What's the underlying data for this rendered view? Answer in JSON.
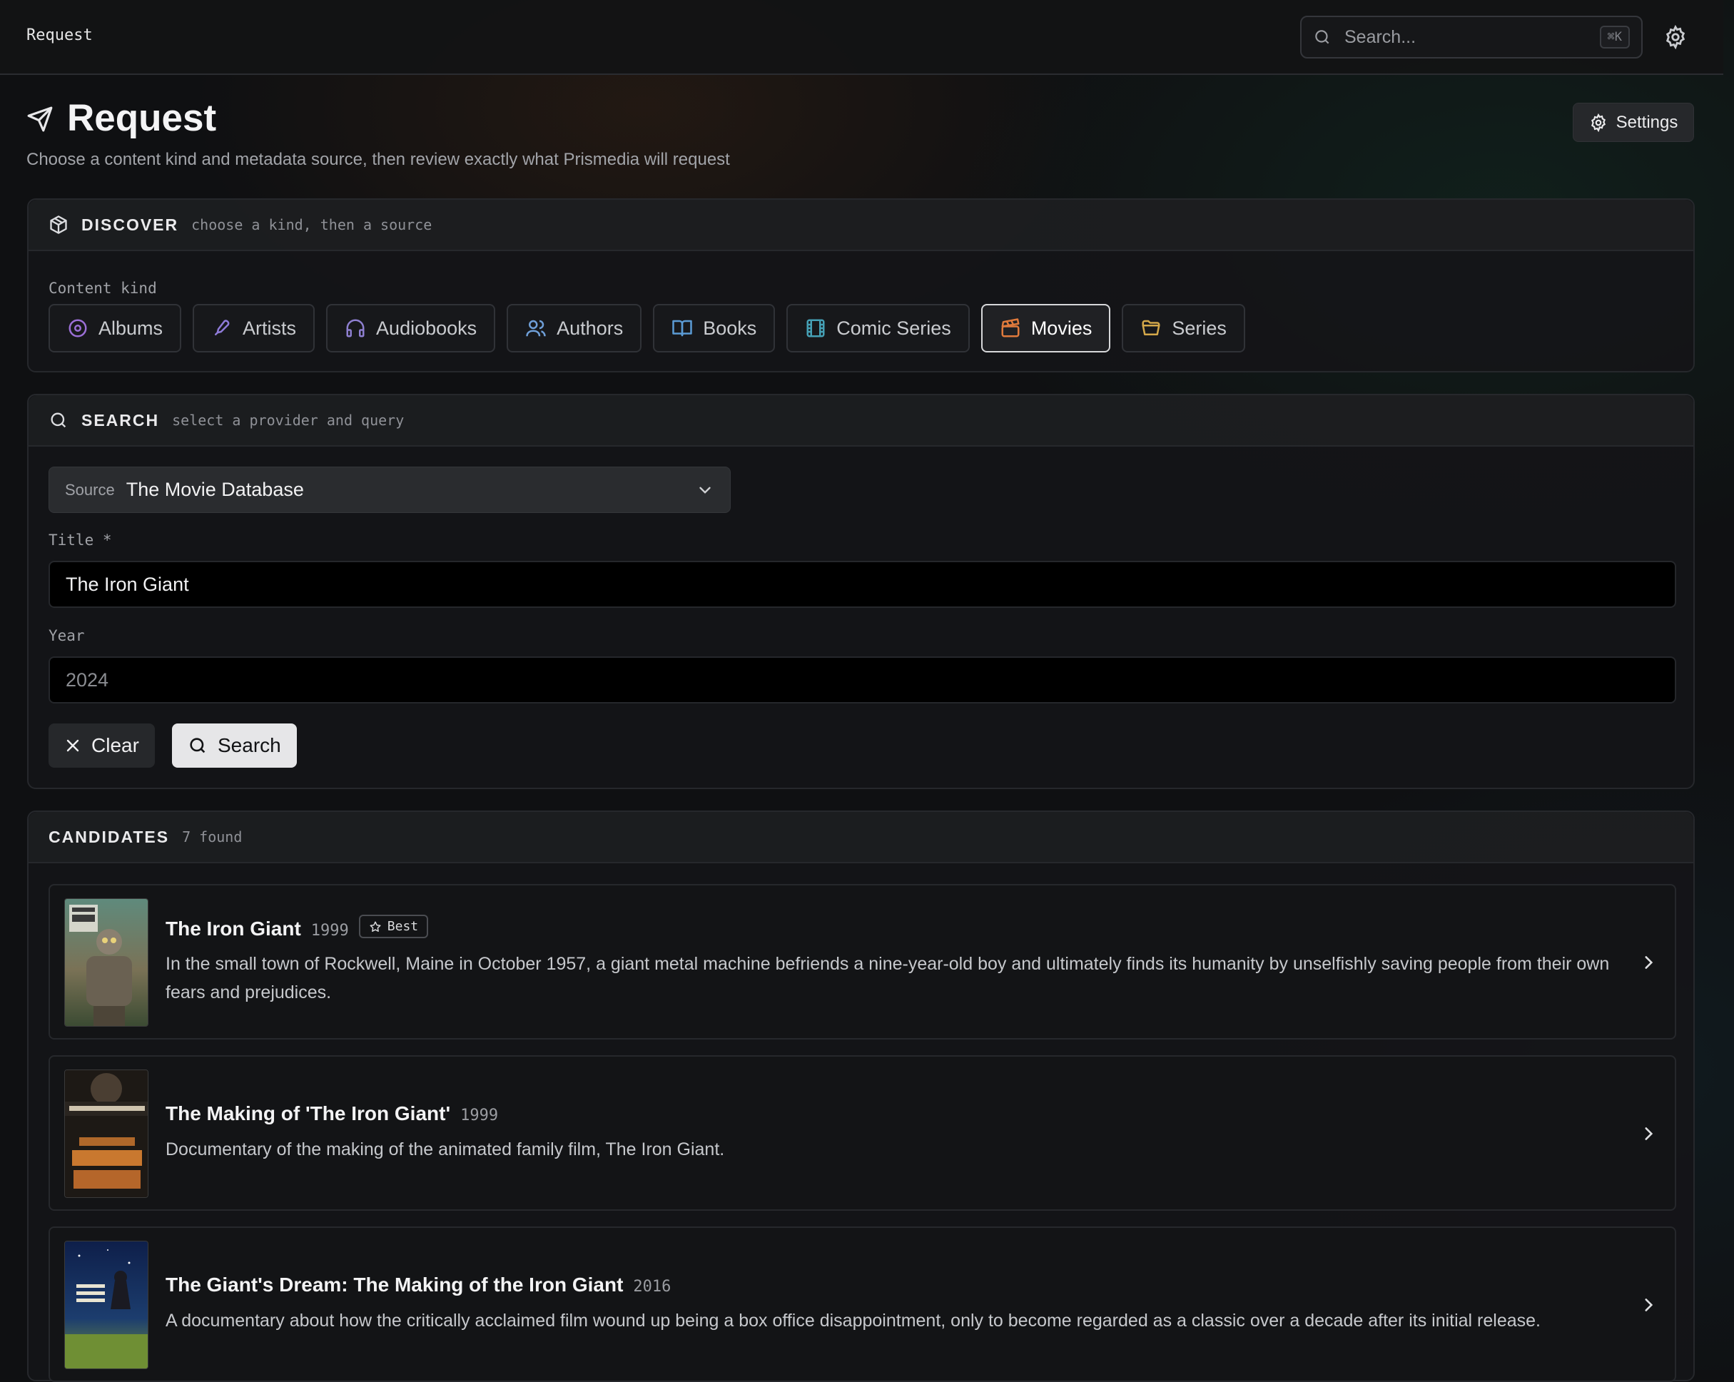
{
  "topbar": {
    "breadcrumb": "Request",
    "search_placeholder": "Search...",
    "shortcut": "⌘K",
    "gear_icon": "gear-icon"
  },
  "header": {
    "title": "Request",
    "subtitle": "Choose a content kind and metadata source, then review exactly what Prismedia will request",
    "settings_label": "Settings"
  },
  "discover": {
    "title": "DISCOVER",
    "hint": "choose a kind, then a source",
    "kind_label": "Content kind",
    "kinds": [
      {
        "label": "Albums",
        "icon": "disc-icon",
        "color": "#9b6fd6"
      },
      {
        "label": "Artists",
        "icon": "mic-icon",
        "color": "#8f7bd9"
      },
      {
        "label": "Audiobooks",
        "icon": "headphones-icon",
        "color": "#8e7fd0"
      },
      {
        "label": "Authors",
        "icon": "users-icon",
        "color": "#6f9fd8"
      },
      {
        "label": "Books",
        "icon": "book-icon",
        "color": "#5b9bd5"
      },
      {
        "label": "Comic Series",
        "icon": "film-strip-icon",
        "color": "#45a0b5"
      },
      {
        "label": "Movies",
        "icon": "clapperboard-icon",
        "color": "#e07a3c",
        "active": true
      },
      {
        "label": "Series",
        "icon": "folder-icon",
        "color": "#d4a84a"
      }
    ]
  },
  "search": {
    "title": "SEARCH",
    "hint": "select a provider and query",
    "source_label": "Source",
    "source_value": "The Movie Database",
    "title_label": "Title *",
    "title_value": "The Iron Giant",
    "year_label": "Year",
    "year_placeholder": "2024",
    "clear_label": "Clear",
    "search_label": "Search"
  },
  "candidates": {
    "title": "CANDIDATES",
    "count": "7 found",
    "items": [
      {
        "title": "The Iron Giant",
        "year": "1999",
        "badge": "Best",
        "description": "In the small town of Rockwell, Maine in October 1957, a giant metal machine befriends a nine-year-old boy and ultimately finds its humanity by unselfishly saving people from their own fears and prejudices."
      },
      {
        "title": "The Making of 'The Iron Giant'",
        "year": "1999",
        "description": "Documentary of the making of the animated family film, The Iron Giant."
      },
      {
        "title": "The Giant's Dream: The Making of the Iron Giant",
        "year": "2016",
        "description": "A documentary about how the critically acclaimed film wound up being a box office disappointment, only to become regarded as a classic over a decade after its initial release."
      }
    ]
  }
}
